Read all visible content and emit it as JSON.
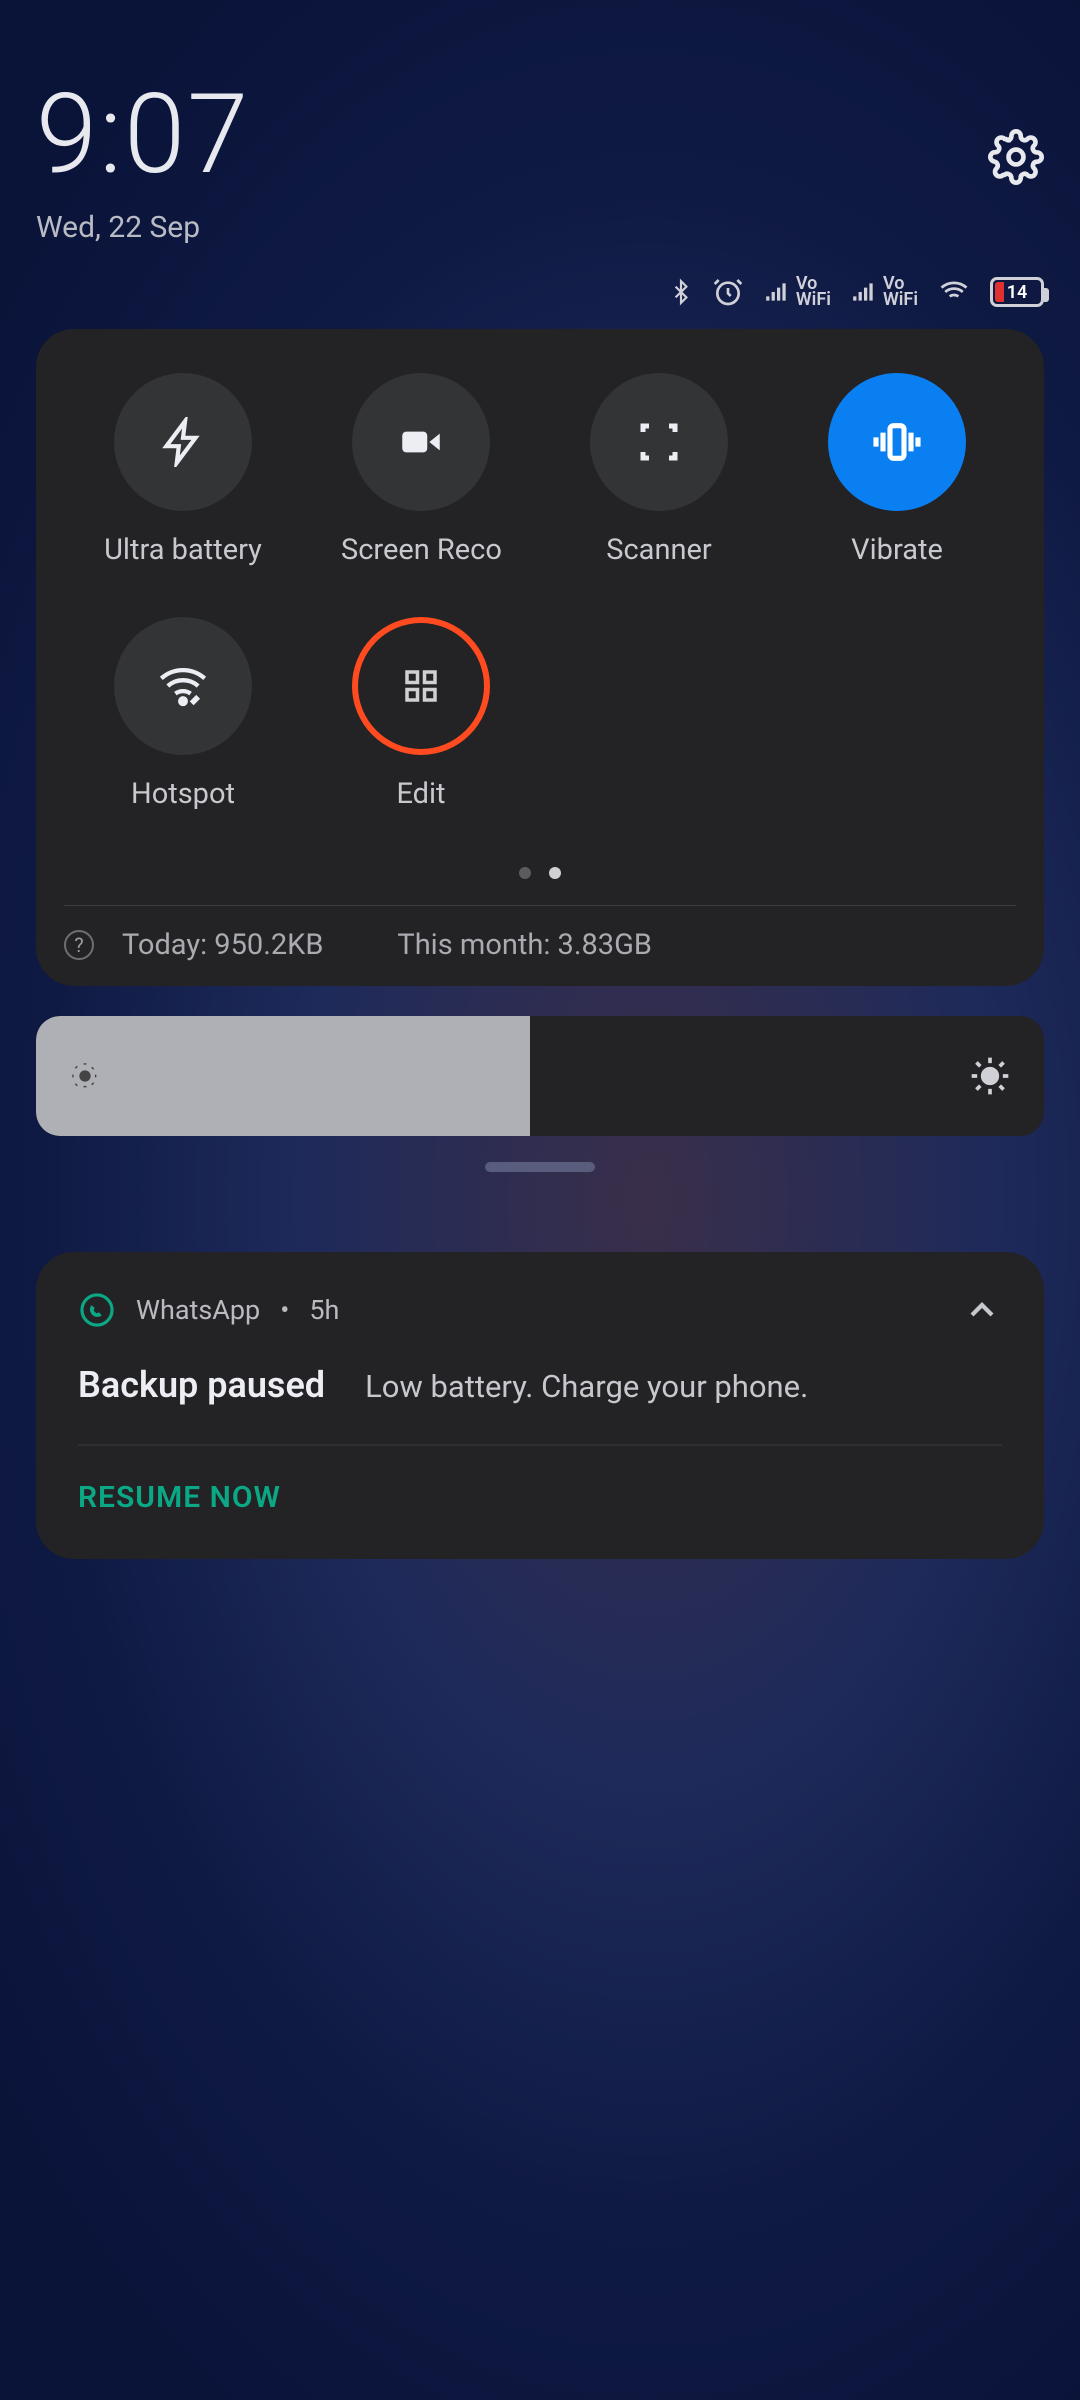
{
  "header": {
    "time": "9:07",
    "date": "Wed, 22 Sep"
  },
  "status": {
    "battery_level": "14",
    "vowifi_label_top": "Vo",
    "vowifi_label_bottom": "WiFi"
  },
  "qs": {
    "tiles": [
      {
        "label": "Ultra battery",
        "icon": "bolt",
        "state": "off"
      },
      {
        "label": "Screen Recorder",
        "icon": "video",
        "state": "off"
      },
      {
        "label": "Scanner",
        "icon": "scan",
        "state": "off"
      },
      {
        "label": "Vibrate",
        "icon": "vibrate",
        "state": "on"
      },
      {
        "label": "Hotspot",
        "icon": "hotspot",
        "state": "off"
      },
      {
        "label": "Edit",
        "icon": "grid",
        "state": "edit"
      }
    ],
    "data_today_label": "Today: 950.2KB",
    "data_month_label": "This month: 3.83GB",
    "pages": 2,
    "active_page": 1
  },
  "brightness": {
    "percent": 49
  },
  "notification": {
    "app": "WhatsApp",
    "age": "5h",
    "sep": "•",
    "title": "Backup paused",
    "text": "Low battery. Charge your phone.",
    "action": "RESUME NOW"
  },
  "colors": {
    "accent_blue": "#0a7ff2",
    "accent_orange": "#ff4b1f",
    "whatsapp_green": "#0aa884",
    "panel_bg": "#232325"
  }
}
